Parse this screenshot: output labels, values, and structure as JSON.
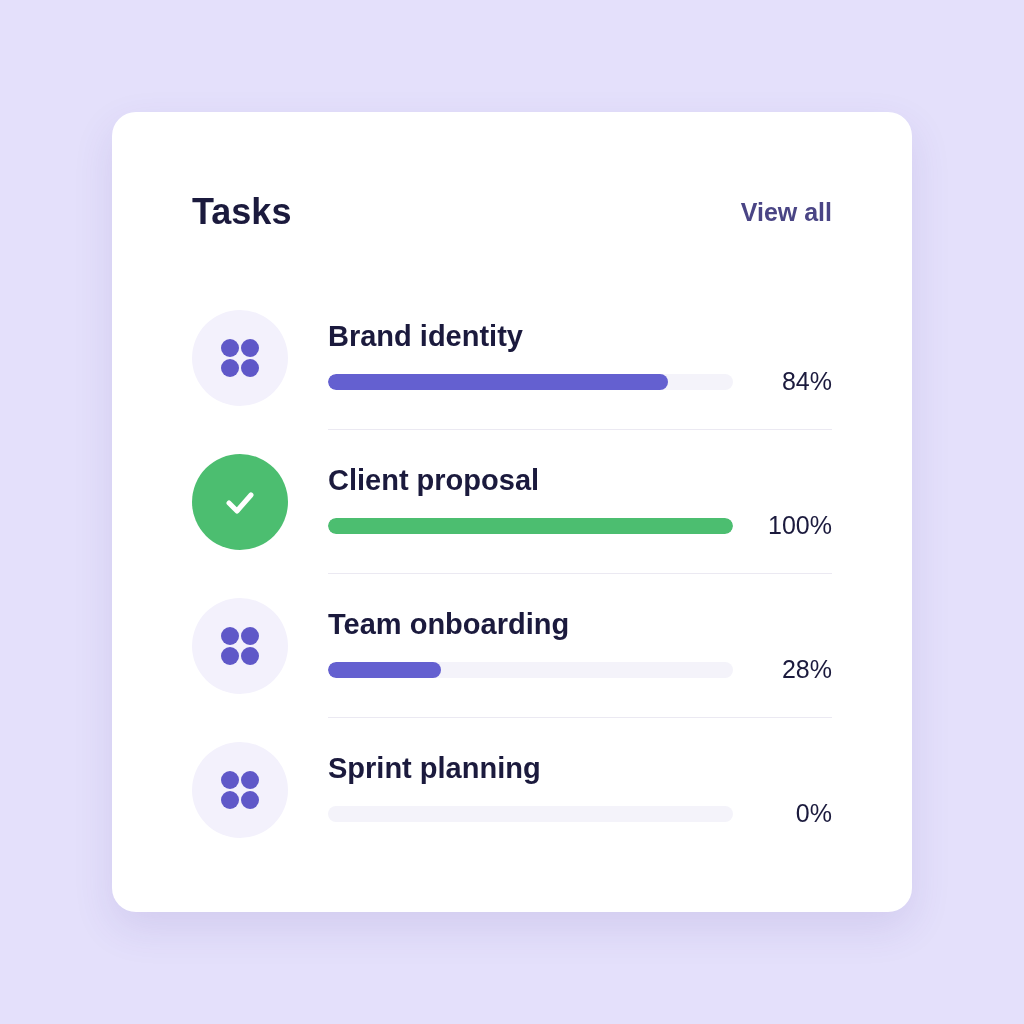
{
  "card": {
    "title": "Tasks",
    "link": "View all"
  },
  "tasks": [
    {
      "name": "Brand identity",
      "done": false,
      "level": 0.84,
      "reading": "84%"
    },
    {
      "name": "Client proposal",
      "done": true,
      "level": 1.0,
      "reading": "100%"
    },
    {
      "name": "Team onboarding",
      "done": false,
      "level": 0.28,
      "reading": "28%"
    },
    {
      "name": "Sprint planning",
      "done": false,
      "level": 0,
      "reading": "0%"
    }
  ]
}
